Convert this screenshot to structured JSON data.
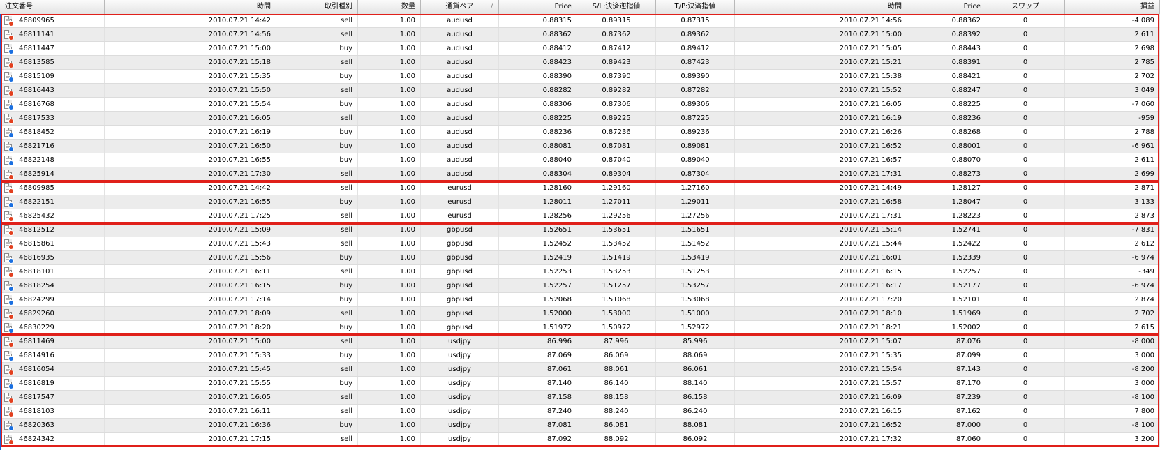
{
  "columns": [
    {
      "key": "id",
      "label": "注文番号",
      "align": "l"
    },
    {
      "key": "time",
      "label": "時間",
      "align": "r"
    },
    {
      "key": "type",
      "label": "取引種別",
      "align": "r"
    },
    {
      "key": "qty",
      "label": "数量",
      "align": "r"
    },
    {
      "key": "pair",
      "label": "通貨ペア",
      "align": "c",
      "sorted": true
    },
    {
      "key": "price",
      "label": "Price",
      "align": "r"
    },
    {
      "key": "sl",
      "label": "S/L:決済逆指値",
      "align": "c"
    },
    {
      "key": "tp",
      "label": "T/P:決済指値",
      "align": "c"
    },
    {
      "key": "ctime",
      "label": "時間",
      "align": "r"
    },
    {
      "key": "cprice",
      "label": "Price",
      "align": "r"
    },
    {
      "key": "swap",
      "label": "スワップ",
      "align": "c"
    },
    {
      "key": "pl",
      "label": "損益",
      "align": "r"
    }
  ],
  "sort_indicator": "/",
  "rows": [
    [
      "46809965",
      "2010.07.21 14:42",
      "sell",
      "1.00",
      "audusd",
      "0.88315",
      "0.89315",
      "0.87315",
      "2010.07.21 14:56",
      "0.88362",
      "0",
      "-4 089"
    ],
    [
      "46811141",
      "2010.07.21 14:56",
      "sell",
      "1.00",
      "audusd",
      "0.88362",
      "0.87362",
      "0.89362",
      "2010.07.21 15:00",
      "0.88392",
      "0",
      "2 611"
    ],
    [
      "46811447",
      "2010.07.21 15:00",
      "buy",
      "1.00",
      "audusd",
      "0.88412",
      "0.87412",
      "0.89412",
      "2010.07.21 15:05",
      "0.88443",
      "0",
      "2 698"
    ],
    [
      "46813585",
      "2010.07.21 15:18",
      "sell",
      "1.00",
      "audusd",
      "0.88423",
      "0.89423",
      "0.87423",
      "2010.07.21 15:21",
      "0.88391",
      "0",
      "2 785"
    ],
    [
      "46815109",
      "2010.07.21 15:35",
      "buy",
      "1.00",
      "audusd",
      "0.88390",
      "0.87390",
      "0.89390",
      "2010.07.21 15:38",
      "0.88421",
      "0",
      "2 702"
    ],
    [
      "46816443",
      "2010.07.21 15:50",
      "sell",
      "1.00",
      "audusd",
      "0.88282",
      "0.89282",
      "0.87282",
      "2010.07.21 15:52",
      "0.88247",
      "0",
      "3 049"
    ],
    [
      "46816768",
      "2010.07.21 15:54",
      "buy",
      "1.00",
      "audusd",
      "0.88306",
      "0.87306",
      "0.89306",
      "2010.07.21 16:05",
      "0.88225",
      "0",
      "-7 060"
    ],
    [
      "46817533",
      "2010.07.21 16:05",
      "sell",
      "1.00",
      "audusd",
      "0.88225",
      "0.89225",
      "0.87225",
      "2010.07.21 16:19",
      "0.88236",
      "0",
      "-959"
    ],
    [
      "46818452",
      "2010.07.21 16:19",
      "buy",
      "1.00",
      "audusd",
      "0.88236",
      "0.87236",
      "0.89236",
      "2010.07.21 16:26",
      "0.88268",
      "0",
      "2 788"
    ],
    [
      "46821716",
      "2010.07.21 16:50",
      "buy",
      "1.00",
      "audusd",
      "0.88081",
      "0.87081",
      "0.89081",
      "2010.07.21 16:52",
      "0.88001",
      "0",
      "-6 961"
    ],
    [
      "46822148",
      "2010.07.21 16:55",
      "buy",
      "1.00",
      "audusd",
      "0.88040",
      "0.87040",
      "0.89040",
      "2010.07.21 16:57",
      "0.88070",
      "0",
      "2 611"
    ],
    [
      "46825914",
      "2010.07.21 17:30",
      "sell",
      "1.00",
      "audusd",
      "0.88304",
      "0.89304",
      "0.87304",
      "2010.07.21 17:31",
      "0.88273",
      "0",
      "2 699"
    ],
    [
      "46809985",
      "2010.07.21 14:42",
      "sell",
      "1.00",
      "eurusd",
      "1.28160",
      "1.29160",
      "1.27160",
      "2010.07.21 14:49",
      "1.28127",
      "0",
      "2 871"
    ],
    [
      "46822151",
      "2010.07.21 16:55",
      "buy",
      "1.00",
      "eurusd",
      "1.28011",
      "1.27011",
      "1.29011",
      "2010.07.21 16:58",
      "1.28047",
      "0",
      "3 133"
    ],
    [
      "46825432",
      "2010.07.21 17:25",
      "sell",
      "1.00",
      "eurusd",
      "1.28256",
      "1.29256",
      "1.27256",
      "2010.07.21 17:31",
      "1.28223",
      "0",
      "2 873"
    ],
    [
      "46812512",
      "2010.07.21 15:09",
      "sell",
      "1.00",
      "gbpusd",
      "1.52651",
      "1.53651",
      "1.51651",
      "2010.07.21 15:14",
      "1.52741",
      "0",
      "-7 831"
    ],
    [
      "46815861",
      "2010.07.21 15:43",
      "sell",
      "1.00",
      "gbpusd",
      "1.52452",
      "1.53452",
      "1.51452",
      "2010.07.21 15:44",
      "1.52422",
      "0",
      "2 612"
    ],
    [
      "46816935",
      "2010.07.21 15:56",
      "buy",
      "1.00",
      "gbpusd",
      "1.52419",
      "1.51419",
      "1.53419",
      "2010.07.21 16:01",
      "1.52339",
      "0",
      "-6 974"
    ],
    [
      "46818101",
      "2010.07.21 16:11",
      "sell",
      "1.00",
      "gbpusd",
      "1.52253",
      "1.53253",
      "1.51253",
      "2010.07.21 16:15",
      "1.52257",
      "0",
      "-349"
    ],
    [
      "46818254",
      "2010.07.21 16:15",
      "buy",
      "1.00",
      "gbpusd",
      "1.52257",
      "1.51257",
      "1.53257",
      "2010.07.21 16:17",
      "1.52177",
      "0",
      "-6 974"
    ],
    [
      "46824299",
      "2010.07.21 17:14",
      "buy",
      "1.00",
      "gbpusd",
      "1.52068",
      "1.51068",
      "1.53068",
      "2010.07.21 17:20",
      "1.52101",
      "0",
      "2 874"
    ],
    [
      "46829260",
      "2010.07.21 18:09",
      "sell",
      "1.00",
      "gbpusd",
      "1.52000",
      "1.53000",
      "1.51000",
      "2010.07.21 18:10",
      "1.51969",
      "0",
      "2 702"
    ],
    [
      "46830229",
      "2010.07.21 18:20",
      "buy",
      "1.00",
      "gbpusd",
      "1.51972",
      "1.50972",
      "1.52972",
      "2010.07.21 18:21",
      "1.52002",
      "0",
      "2 615"
    ],
    [
      "46811469",
      "2010.07.21 15:00",
      "sell",
      "1.00",
      "usdjpy",
      "86.996",
      "87.996",
      "85.996",
      "2010.07.21 15:07",
      "87.076",
      "0",
      "-8 000"
    ],
    [
      "46814916",
      "2010.07.21 15:33",
      "buy",
      "1.00",
      "usdjpy",
      "87.069",
      "86.069",
      "88.069",
      "2010.07.21 15:35",
      "87.099",
      "0",
      "3 000"
    ],
    [
      "46816054",
      "2010.07.21 15:45",
      "sell",
      "1.00",
      "usdjpy",
      "87.061",
      "88.061",
      "86.061",
      "2010.07.21 15:54",
      "87.143",
      "0",
      "-8 200"
    ],
    [
      "46816819",
      "2010.07.21 15:55",
      "buy",
      "1.00",
      "usdjpy",
      "87.140",
      "86.140",
      "88.140",
      "2010.07.21 15:57",
      "87.170",
      "0",
      "3 000"
    ],
    [
      "46817547",
      "2010.07.21 16:05",
      "sell",
      "1.00",
      "usdjpy",
      "87.158",
      "88.158",
      "86.158",
      "2010.07.21 16:09",
      "87.239",
      "0",
      "-8 100"
    ],
    [
      "46818103",
      "2010.07.21 16:11",
      "sell",
      "1.00",
      "usdjpy",
      "87.240",
      "88.240",
      "86.240",
      "2010.07.21 16:15",
      "87.162",
      "0",
      "7 800"
    ],
    [
      "46820363",
      "2010.07.21 16:36",
      "buy",
      "1.00",
      "usdjpy",
      "87.081",
      "86.081",
      "88.081",
      "2010.07.21 16:52",
      "87.000",
      "0",
      "-8 100"
    ],
    [
      "46824342",
      "2010.07.21 17:15",
      "sell",
      "1.00",
      "usdjpy",
      "87.092",
      "88.092",
      "86.092",
      "2010.07.21 17:32",
      "87.060",
      "0",
      "3 200"
    ]
  ],
  "colors": {
    "group_border": "#e0201a",
    "sell_marker": "#e2401f",
    "buy_marker": "#1a6fe0",
    "row_alt": "#ececec"
  },
  "icons": {
    "row": "order-document-icon"
  }
}
